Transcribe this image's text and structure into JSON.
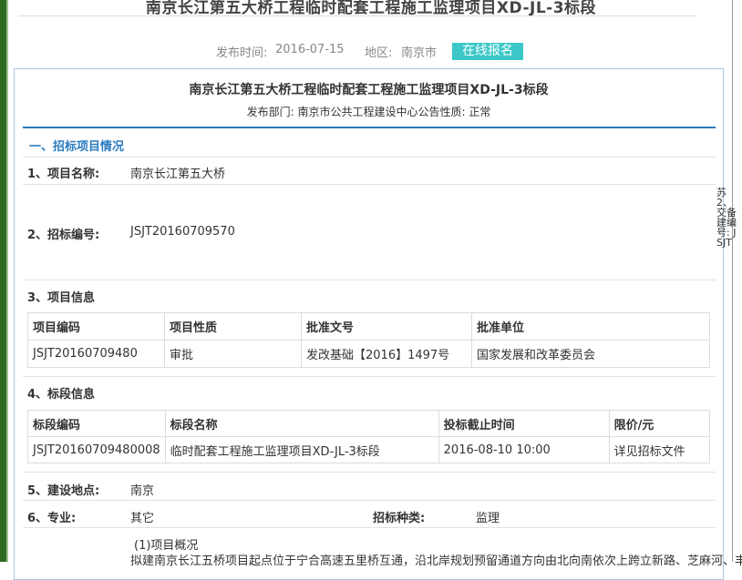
{
  "page_title": "南京长江第五大桥工程临时配套工程施工监理项目XD-JL-3标段",
  "meta": {
    "publish_time_label": "发布时间:",
    "publish_time": "2016-07-15",
    "region_label": "地区:",
    "region": "南京市",
    "enroll_button": "在线报名"
  },
  "doc": {
    "title": "南京长江第五大桥工程临时配套工程施工监理项目XD-JL-3标段",
    "subtitle": "发布部门: 南京市公共工程建设中心公告性质: 正常"
  },
  "section1_title": "一、招标项目情况",
  "rows": {
    "project_name_label": "1、项目名称:",
    "project_name": "南京长江第五大桥",
    "bid_no_label": "2、招标编号:",
    "bid_no": "JSJT20160709570",
    "project_info_label": "3、项目信息",
    "segment_info_label": "4、标段信息",
    "location_label": "5、建设地点:",
    "location": "南京",
    "specialty_label": "6、专业:",
    "specialty": "其它",
    "bid_type_label": "招标种类:",
    "bid_type": "监理"
  },
  "project_table": {
    "headers": [
      "项目编码",
      "项目性质",
      "批准文号",
      "批准单位"
    ],
    "row": [
      "JSJT20160709480",
      "审批",
      "发改基础【2016】1497号",
      "国家发展和改革委员会"
    ]
  },
  "segment_table": {
    "headers": [
      "标段编码",
      "标段名称",
      "投标截止时间",
      "限价/元"
    ],
    "row": [
      "JSJT20160709480008",
      "临时配套工程施工监理项目XD-JL-3标段",
      "2016-08-10 10:00",
      "详见招标文件"
    ]
  },
  "overview_heading": "(1)项目概况",
  "overview_text": "拟建南京长江五桥项目起点位于宁合高速五里桥互通，沿北岸规划预留通道方向由北向南依次上跨立新路、芝麻河、丰子",
  "side_text": "苏2、交备建编号: JSJT"
}
